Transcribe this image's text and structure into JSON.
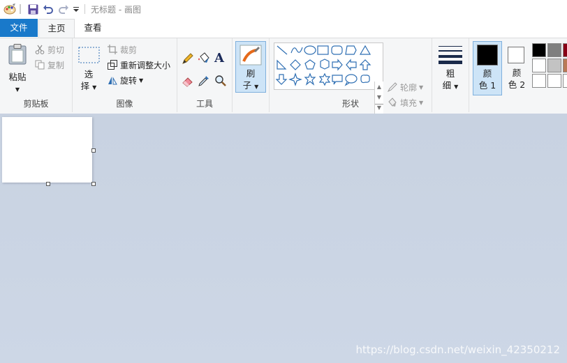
{
  "window": {
    "title": "无标题 - 画图"
  },
  "tabs": {
    "file": "文件",
    "home": "主页",
    "view": "查看"
  },
  "clipboard": {
    "group_label": "剪贴板",
    "paste": "粘贴",
    "cut": "剪切",
    "copy": "复制"
  },
  "image": {
    "group_label": "图像",
    "select_top": "选",
    "select_bottom": "择",
    "crop": "裁剪",
    "resize": "重新调整大小",
    "rotate": "旋转"
  },
  "tools": {
    "group_label": "工具",
    "text_tool": "A"
  },
  "brushes": {
    "top": "刷",
    "bottom": "子"
  },
  "shapes": {
    "group_label": "形状",
    "outline": "轮廓",
    "fill": "填充"
  },
  "size": {
    "top": "粗",
    "bottom": "细"
  },
  "colors": {
    "color1_top": "颜",
    "color1_bottom": "色 1",
    "color2_top": "颜",
    "color2_bottom": "色 2",
    "color1_value": "#000000",
    "color2_value": "#ffffff",
    "palette": [
      "#000000",
      "#7f7f7f",
      "#880015",
      "#ffffff",
      "#c3c3c3",
      "#b97a57",
      "#ffffff",
      "#ffffff",
      "#ffffff"
    ]
  },
  "watermark": "https://blog.csdn.net/weixin_42350212"
}
